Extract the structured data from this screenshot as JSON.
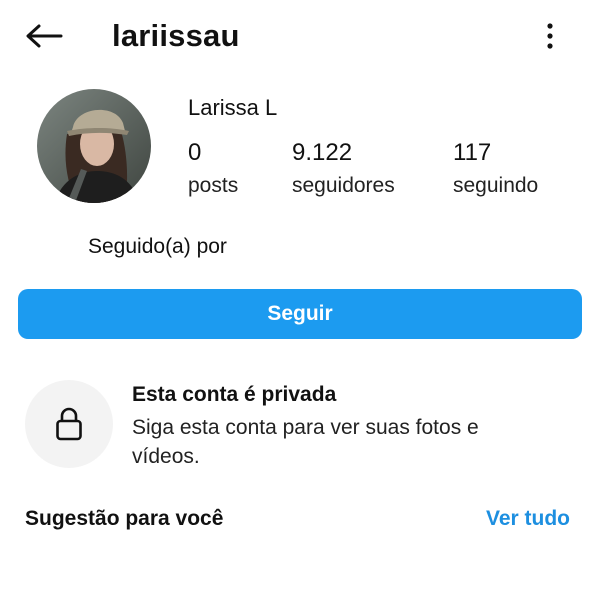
{
  "header": {
    "username": "lariissau",
    "back_icon": "arrow-left-icon",
    "more_icon": "more-vertical-icon"
  },
  "profile": {
    "display_name": "Larissa L",
    "stats": {
      "posts_count": "0",
      "posts_label": "posts",
      "followers_count": "9.122",
      "followers_label": "seguidores",
      "following_count": "117",
      "following_label": "seguindo"
    },
    "followed_by": "Seguido(a) por"
  },
  "actions": {
    "follow_label": "Seguir",
    "follow_color": "#1c9bf0"
  },
  "private_notice": {
    "icon": "lock-icon",
    "title": "Esta conta é privada",
    "description": "Siga esta conta para ver suas fotos e vídeos."
  },
  "suggestions": {
    "title": "Sugestão para você",
    "see_all_label": "Ver tudo",
    "see_all_color": "#1d8fe0"
  }
}
